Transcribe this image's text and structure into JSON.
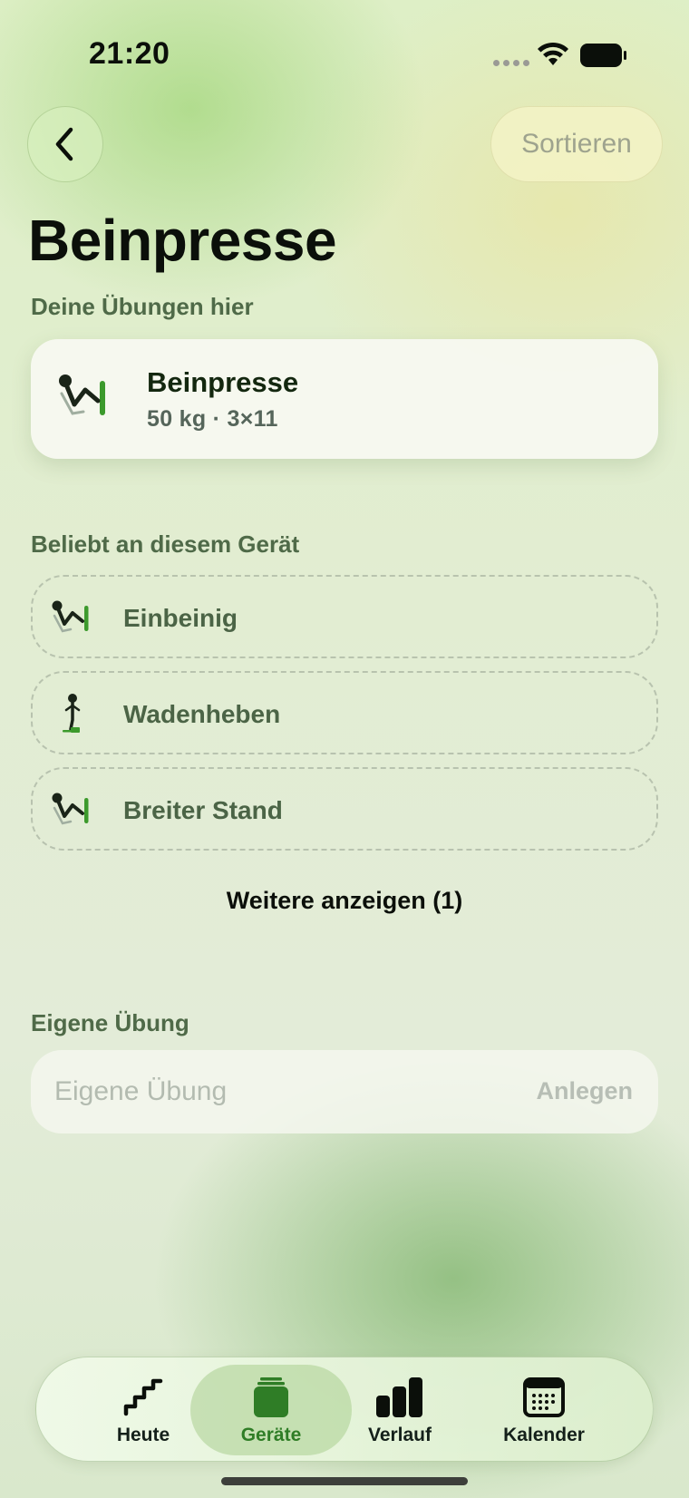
{
  "status_bar": {
    "time": "21:20"
  },
  "header": {
    "back_icon": "chevron-left-icon",
    "sort_label": "Sortieren"
  },
  "page": {
    "title": "Beinpresse"
  },
  "my_exercises": {
    "section_label": "Deine Übungen hier",
    "items": [
      {
        "icon": "leg-press-icon",
        "title": "Beinpresse",
        "subtitle": "50 kg · 3×11"
      }
    ]
  },
  "popular": {
    "section_label": "Beliebt an diesem Gerät",
    "items": [
      {
        "icon": "leg-press-icon",
        "label": "Einbeinig"
      },
      {
        "icon": "calf-raise-icon",
        "label": "Wadenheben"
      },
      {
        "icon": "leg-press-icon",
        "label": "Breiter Stand"
      }
    ],
    "more_label": "Weitere anzeigen (1)"
  },
  "custom_exercise": {
    "section_label": "Eigene Übung",
    "placeholder": "Eigene Übung",
    "value": "",
    "create_label": "Anlegen"
  },
  "tab_bar": {
    "active": "Geräte",
    "tabs": [
      {
        "label": "Heute",
        "icon": "stairs-icon"
      },
      {
        "label": "Geräte",
        "icon": "equipment-icon"
      },
      {
        "label": "Verlauf",
        "icon": "bar-chart-icon"
      },
      {
        "label": "Kalender",
        "icon": "calendar-icon"
      }
    ]
  },
  "colors": {
    "accent_green": "#2f7d26",
    "section_label": "#4f6a48",
    "text_primary": "#0b0f0a"
  }
}
